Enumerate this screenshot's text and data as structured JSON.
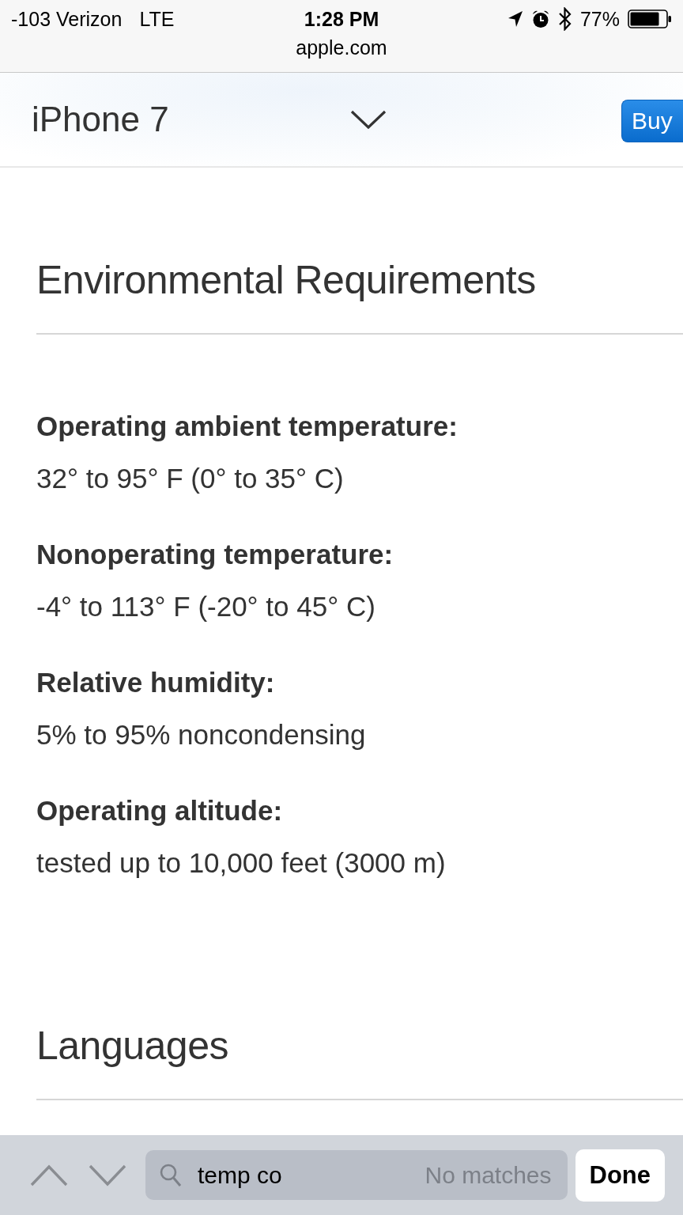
{
  "status_bar": {
    "carrier": "-103 Verizon",
    "network": "LTE",
    "time": "1:28 PM",
    "battery_percent": "77%",
    "url": "apple.com"
  },
  "nav": {
    "title": "iPhone 7",
    "buy_button": "Buy"
  },
  "sections": [
    {
      "heading": "Environmental Requirements",
      "specs": [
        {
          "label": "Operating ambient temperature:",
          "value": "32° to 95° F (0° to 35° C)"
        },
        {
          "label": "Nonoperating temperature:",
          "value": "-4° to 113° F (-20° to 45° C)"
        },
        {
          "label": "Relative humidity:",
          "value": "5% to 95% noncondensing"
        },
        {
          "label": "Operating altitude:",
          "value": "tested up to 10,000 feet (3000 m)"
        }
      ]
    },
    {
      "heading": "Languages"
    }
  ],
  "find_bar": {
    "previous": {
      "disabled": true
    },
    "next": {
      "disabled": true
    },
    "query": "temp co",
    "status": "No matches",
    "done_button": "Done"
  }
}
